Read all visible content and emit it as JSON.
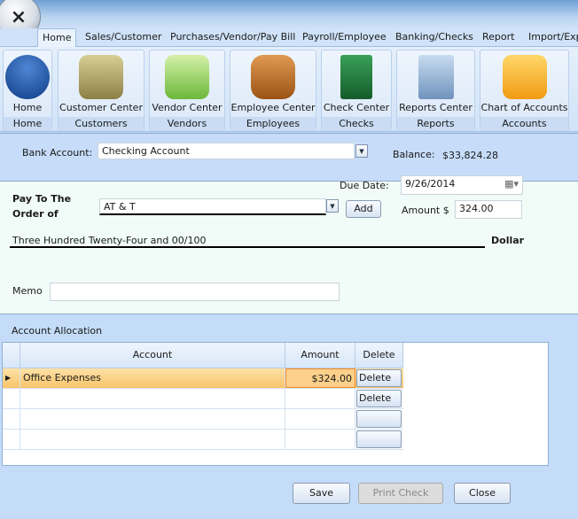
{
  "ribbon_tabs": [
    "Home",
    "Sales/Customer",
    "Purchases/Vendor/Pay Bill",
    "Payroll/Employee",
    "Banking/Checks",
    "Report",
    "Import/Exp"
  ],
  "ribbon_groups": [
    {
      "label": "Home",
      "group": "Home",
      "icon": "home-icon",
      "color": "#1a4f9a"
    },
    {
      "label": "Customer Center",
      "group": "Customers",
      "icon": "customer-folder-icon",
      "color": "#a89a5c"
    },
    {
      "label": "Vendor Center",
      "group": "Vendors",
      "icon": "vendor-book-icon",
      "color": "#8cc850"
    },
    {
      "label": "Employee Center",
      "group": "Employees",
      "icon": "employees-icon",
      "color": "#b66a22"
    },
    {
      "label": "Check Center",
      "group": "Checks",
      "icon": "checkbook-icon",
      "color": "#1f7a3a"
    },
    {
      "label": "Reports Center",
      "group": "Reports",
      "icon": "reports-binder-icon",
      "color": "#7fa0c4"
    },
    {
      "label": "Chart of Accounts",
      "group": "Accounts",
      "icon": "accounts-folder-icon",
      "color": "#f5a623"
    }
  ],
  "bank": {
    "label": "Bank Account:",
    "value": "Checking Account",
    "balance_label": "Balance:",
    "balance": "$33,824.28"
  },
  "check": {
    "due_label": "Due Date:",
    "due_date": "9/26/2014",
    "pay_to_line1": "Pay To The",
    "pay_to_line2": "Order of",
    "payee": "AT & T",
    "add_label": "Add",
    "amount_label": "Amount $",
    "amount": "324.00",
    "words": "Three Hundred Twenty-Four and 00/100",
    "dollar_label": "Dollar",
    "memo_label": "Memo",
    "memo": ""
  },
  "allocation": {
    "title": "Account Allocation",
    "columns": [
      "Account",
      "Amount",
      "Delete"
    ],
    "rows": [
      {
        "account": "Office Expenses",
        "amount": "$324.00",
        "delete": "Delete"
      },
      {
        "account": "",
        "amount": "",
        "delete": "Delete"
      },
      {
        "account": "",
        "amount": "",
        "delete": ""
      },
      {
        "account": "",
        "amount": "",
        "delete": ""
      }
    ]
  },
  "footer": {
    "save": "Save",
    "print": "Print Check",
    "close": "Close"
  }
}
